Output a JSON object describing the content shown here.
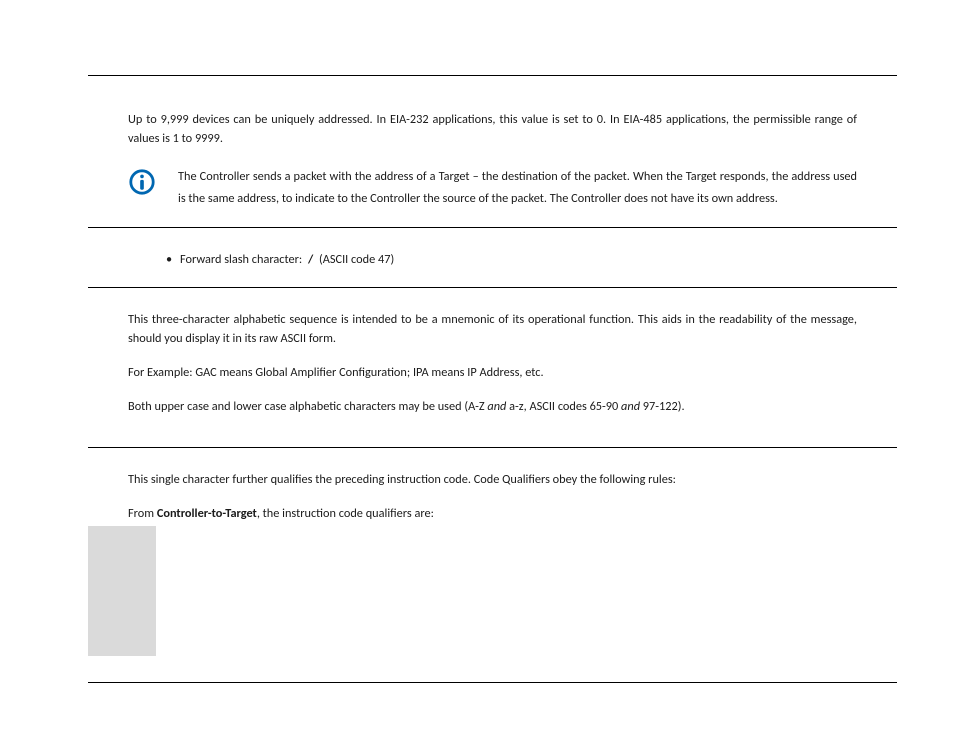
{
  "intro": {
    "paragraph": "Up to 9,999 devices can be uniquely addressed. In EIA-232 applications, this value is set to 0. In EIA-485 applications, the permissible range of values is 1 to 9999."
  },
  "note": {
    "icon": "info-circle-icon",
    "color": "#0067b1",
    "text": "The Controller sends a packet with the address of a Target – the destination of the packet. When the Target responds, the address used is the same address, to indicate to the Controller the source of the packet. The Controller does not have its own address."
  },
  "bullet": {
    "prefix": "Forward slash character:  ",
    "slash": "/",
    "suffix": "  (ASCII code 47)"
  },
  "mnemonic": {
    "p1": "This three-character alphabetic sequence is intended to be a mnemonic of its operational function. This aids in the readability of the message, should you display it in its raw ASCII form.",
    "p2": "For Example: GAC means Global Amplifier Configuration; IPA means IP Address, etc.",
    "p3_a": "Both upper case and lower case alphabetic characters may be used (A-Z ",
    "p3_and1": "and",
    "p3_b": " a-z, ASCII codes 65-90 ",
    "p3_and2": "and",
    "p3_c": " 97-122)."
  },
  "qualifier": {
    "p1": "This single character further qualifies the preceding instruction code. Code Qualifiers obey the following rules:",
    "p2_a": "From ",
    "p2_bold": "Controller-to-Target",
    "p2_b": ", the instruction code qualifiers are:"
  }
}
